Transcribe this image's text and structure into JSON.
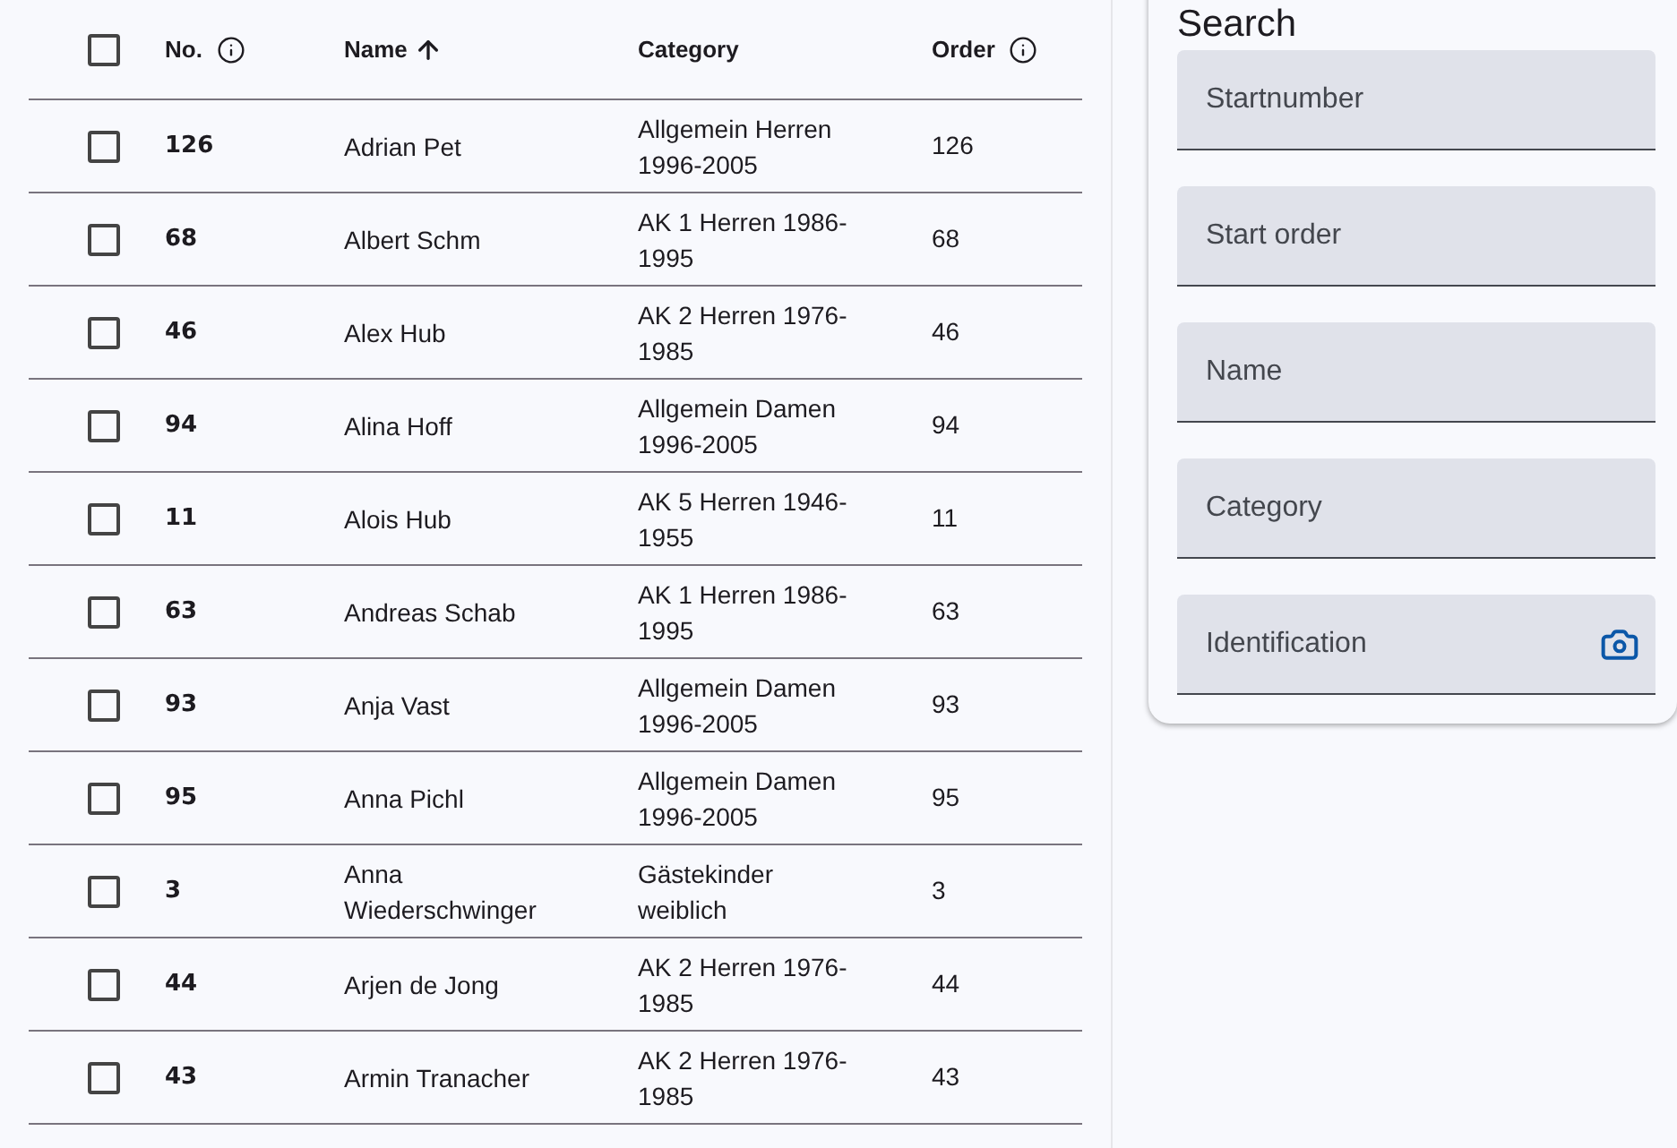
{
  "table": {
    "columns": [
      {
        "label": "No.",
        "kind": "info"
      },
      {
        "label": "Name",
        "kind": "sorted"
      },
      {
        "label": "Category",
        "kind": "plain"
      },
      {
        "label": "Order",
        "kind": "info"
      }
    ],
    "all_checked": false,
    "rows": [
      {
        "checked": false,
        "no": "126",
        "name": "Adrian Pet",
        "category": "Allgemein Herren 1996-2005",
        "order": "126"
      },
      {
        "checked": false,
        "no": "68",
        "name": "Albert Schm",
        "category": "AK 1 Herren 1986-1995",
        "order": "68"
      },
      {
        "checked": false,
        "no": "46",
        "name": "Alex Hub",
        "category": "AK 2 Herren 1976-1985",
        "order": "46"
      },
      {
        "checked": false,
        "no": "94",
        "name": "Alina Hoff",
        "category": "Allgemein Damen 1996-2005",
        "order": "94"
      },
      {
        "checked": false,
        "no": "11",
        "name": "Alois Hub",
        "category": "AK 5 Herren 1946-1955",
        "order": "11"
      },
      {
        "checked": false,
        "no": "63",
        "name": "Andreas Schab",
        "category": "AK 1 Herren 1986-1995",
        "order": "63"
      },
      {
        "checked": false,
        "no": "93",
        "name": "Anja Vast",
        "category": "Allgemein Damen 1996-2005",
        "order": "93"
      },
      {
        "checked": false,
        "no": "95",
        "name": "Anna Pichl",
        "category": "Allgemein Damen 1996-2005",
        "order": "95"
      },
      {
        "checked": false,
        "no": "3",
        "name": "Anna Wiederschwinger",
        "category": "Gästekinder weiblich",
        "order": "3"
      },
      {
        "checked": false,
        "no": "44",
        "name": "Arjen de Jong",
        "category": "AK 2 Herren 1976-1985",
        "order": "44"
      },
      {
        "checked": false,
        "no": "43",
        "name": "Armin Tranacher",
        "category": "AK 2 Herren 1976-1985",
        "order": "43"
      }
    ]
  },
  "search": {
    "title": "Search",
    "fields": [
      {
        "placeholder": "Startnumber",
        "kind": "text"
      },
      {
        "placeholder": "Start order",
        "kind": "text"
      },
      {
        "placeholder": "Name",
        "kind": "text"
      },
      {
        "placeholder": "Category",
        "kind": "text"
      },
      {
        "placeholder": "Identification",
        "kind": "camera"
      }
    ]
  }
}
